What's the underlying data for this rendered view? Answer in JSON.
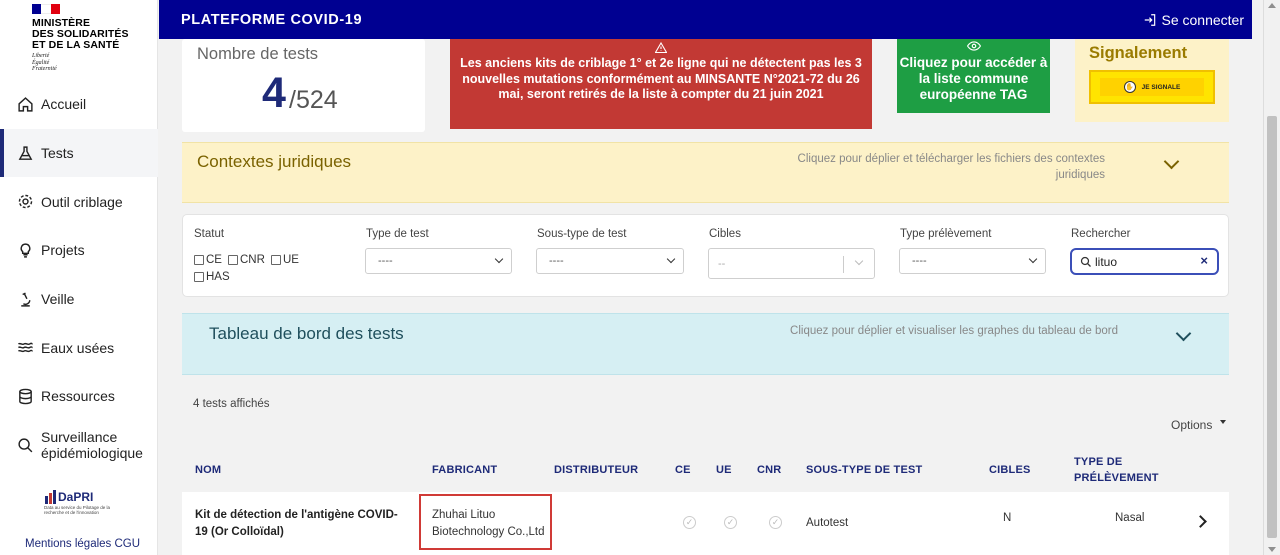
{
  "logo": {
    "title_lines": [
      "MINISTÈRE",
      "DES SOLIDARITÉS",
      "ET DE LA SANTÉ"
    ],
    "motto_lines": [
      "Liberté",
      "Égalité",
      "Fraternité"
    ],
    "flag_colors": [
      "#000091",
      "#ffffff",
      "#e1000f"
    ]
  },
  "header": {
    "title": "PLATEFORME COVID-19",
    "login_label": "Se connecter",
    "bg_color": "#000091"
  },
  "sidebar": {
    "items": [
      {
        "label": "Accueil",
        "icon": "home-icon",
        "active": false
      },
      {
        "label": "Tests",
        "icon": "flask-icon",
        "active": true
      },
      {
        "label": "Outil criblage",
        "icon": "gear-icon",
        "active": false
      },
      {
        "label": "Projets",
        "icon": "bulb-icon",
        "active": false
      },
      {
        "label": "Veille",
        "icon": "microscope-icon",
        "active": false
      },
      {
        "label": "Eaux usées",
        "icon": "waves-icon",
        "active": false
      },
      {
        "label": "Ressources",
        "icon": "database-icon",
        "active": false
      },
      {
        "label": "Surveillance épidémiologique",
        "icon": "magnifier-icon",
        "active": false
      }
    ],
    "dapri_name": "DaPRI",
    "dapri_sub": "Data au service du Pilotage de la recherche et de l'innovation",
    "legal_links": "Mentions légales CGU"
  },
  "stats": {
    "label": "Nombre de tests",
    "shown": "4",
    "total": "/524"
  },
  "alert": {
    "line_a": "Les anciens kits de criblage 1° et 2e ligne qui ne détectent pas les 3 nouvelles mutations conformément au",
    "line_b": "MINSANTE N°2021-72 du 26 mai",
    "line_c": ", seront retirés de la liste à compter du 21 juin 2021",
    "color": "#c23934"
  },
  "tag_card": {
    "text_a": "Cliquez pour accéder à",
    "text_b": "la liste commune européenne TAG",
    "color": "#1e9e44"
  },
  "signalement": {
    "label": "Signalement",
    "button": "JE SIGNALE"
  },
  "legal_context": {
    "title": "Contextes juridiques",
    "hint": "Cliquez pour déplier et télécharger les fichiers des contextes juridiques"
  },
  "filters": {
    "statut_label": "Statut",
    "checkboxes": [
      "CE",
      "CNR",
      "UE",
      "HAS"
    ],
    "type_test_label": "Type de test",
    "type_test_value": "----",
    "sous_type_label": "Sous-type de test",
    "sous_type_value": "----",
    "cibles_label": "Cibles",
    "cibles_placeholder": "--",
    "prelevement_label": "Type prélèvement",
    "prelevement_value": "----",
    "search_label": "Rechercher",
    "search_value": "lituo"
  },
  "dashboard": {
    "title": "Tableau de bord des tests",
    "hint": "Cliquez pour déplier et visualiser les graphes du tableau de bord"
  },
  "results": {
    "count_text": "4 tests affichés",
    "options_label": "Options",
    "columns": [
      "NOM",
      "FABRICANT",
      "DISTRIBUTEUR",
      "CE",
      "UE",
      "CNR",
      "SOUS-TYPE DE TEST",
      "CIBLES",
      "TYPE DE PRÉLÈVEMENT"
    ],
    "rows": [
      {
        "nom": "Kit de détection de l'antigène COVID-19 (Or Colloïdal)",
        "fabricant": "Zhuhai Lituo Biotechnology Co.,Ltd",
        "distributeur": "",
        "sous_type": "Autotest",
        "cibles": "N",
        "prelevement": "Nasal"
      }
    ]
  }
}
